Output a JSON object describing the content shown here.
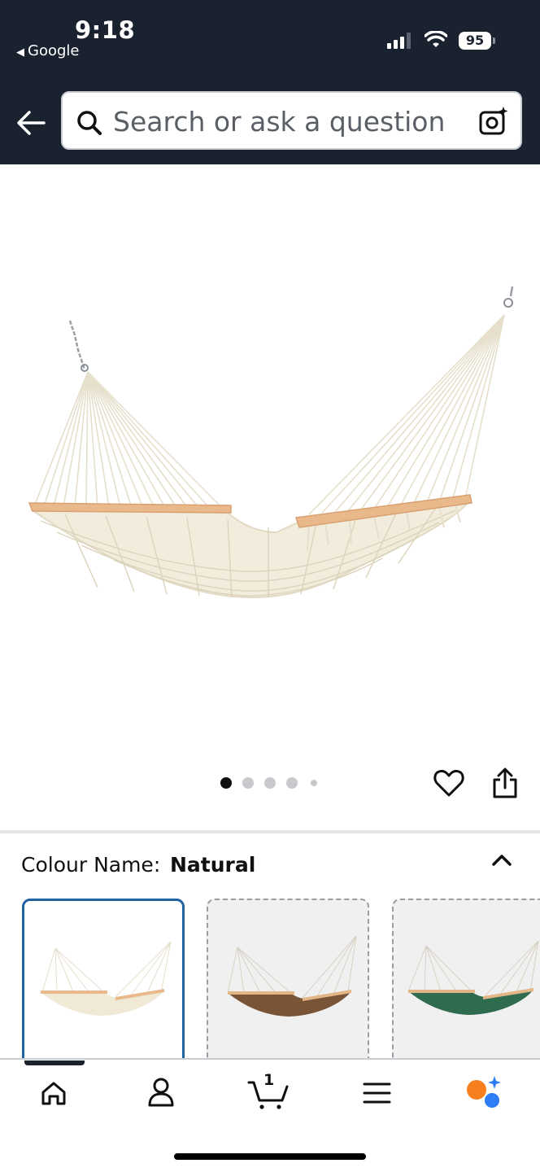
{
  "status_bar": {
    "time": "9:18",
    "back_app": "Google",
    "battery": "95"
  },
  "header": {
    "search_placeholder": "Search or ask a question",
    "icons": [
      "back-arrow-icon",
      "search-icon",
      "camera-lens-icon"
    ]
  },
  "gallery": {
    "image_count": 5,
    "active_index": 0,
    "actions": [
      "heart-icon",
      "share-icon"
    ]
  },
  "variation": {
    "label": "Colour Name:",
    "selected": "Natural",
    "swatches": [
      {
        "color": "natural",
        "selected": true
      },
      {
        "color": "brown",
        "selected": false
      },
      {
        "color": "green",
        "selected": false
      }
    ]
  },
  "bottom_nav": {
    "cart_count": "1",
    "items": [
      "home-icon",
      "account-icon",
      "cart-icon",
      "menu-icon",
      "rufus-ai-icon"
    ],
    "active": "home-icon"
  },
  "colors": {
    "header_bg": "#1a2230",
    "selected_border": "#2162a1",
    "ai_orange": "#f77f1e",
    "ai_blue": "#2e7cf6"
  }
}
